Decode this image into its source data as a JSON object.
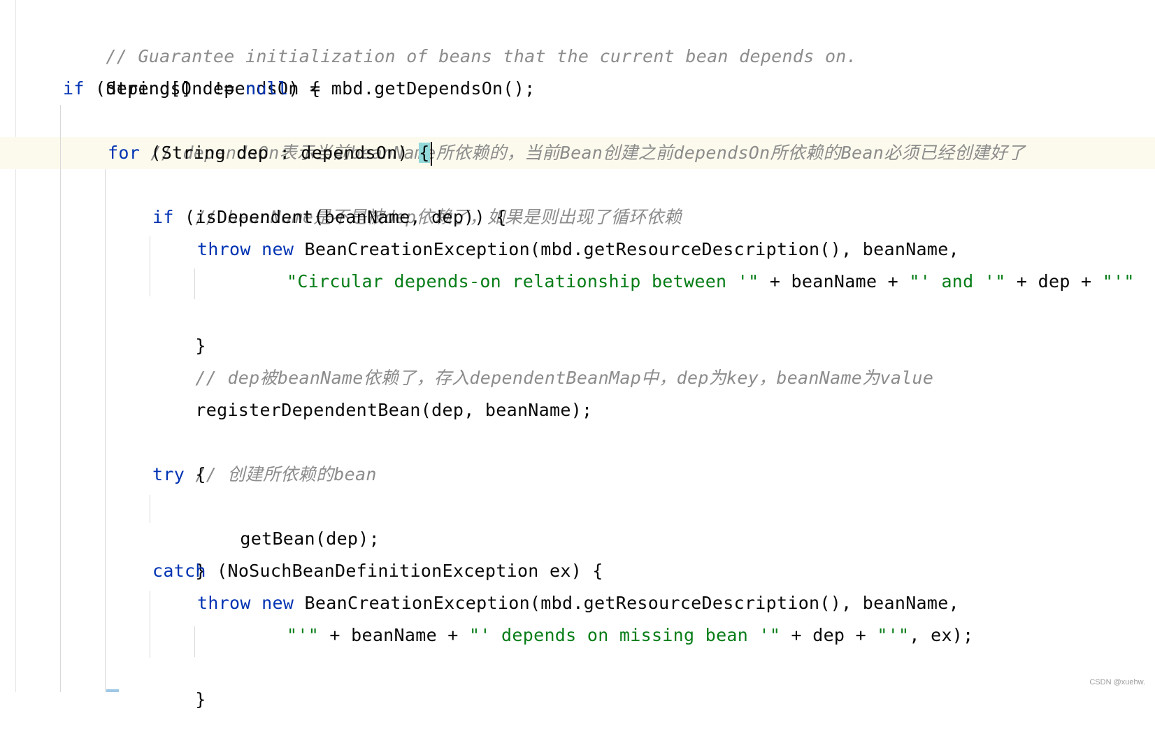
{
  "colors": {
    "keyword": "#0033b3",
    "string": "#067d17",
    "comment": "#8c8c8c",
    "text": "#080808",
    "caret_line": "#fcfaed",
    "brace_match": "#93d9d9"
  },
  "code": {
    "l1": {
      "comment": "// Guarantee initialization of beans that the current bean depends on."
    },
    "l2": {
      "text": "String[] dependsOn = mbd.getDependsOn();"
    },
    "l3": {
      "kw": "if",
      "t1": " (dependsOn != ",
      "kw2": "null",
      "t2": ") {"
    },
    "l4": {
      "comment": "// dependsOn表示当前beanName所依赖的，当前Bean创建之前dependsOn所依赖的Bean必须已经创建好了"
    },
    "l5": {
      "kw": "for",
      "t1": " (String dep : dependsOn) ",
      "brace": "{"
    },
    "l6": {
      "comment": "// beanName是不是被dep依赖了，如果是则出现了循环依赖"
    },
    "l7": {
      "kw": "if",
      "t1": " (isDependent(beanName, dep)) {"
    },
    "l8": {
      "kw": "throw",
      "kw2": "new",
      "t1": " BeanCreationException(mbd.getResourceDescription(), beanName,"
    },
    "l9": {
      "s1": "\"Circular depends-on relationship between '\"",
      "t1": " + beanName + ",
      "s2": "\"' and '\"",
      "t2": " + dep + ",
      "s3": "\"'\""
    },
    "l10": {
      "text": "}"
    },
    "l11": {
      "comment": "// dep被beanName依赖了，存入dependentBeanMap中，dep为key，beanName为value"
    },
    "l12": {
      "text": "registerDependentBean(dep, beanName);"
    },
    "l14": {
      "comment": "// 创建所依赖的bean"
    },
    "l15": {
      "kw": "try",
      "t1": " {"
    },
    "l16": {
      "text": "getBean(dep);"
    },
    "l17": {
      "text": "}"
    },
    "l18": {
      "kw": "catch",
      "t1": " (NoSuchBeanDefinitionException ex) {"
    },
    "l19": {
      "kw": "throw",
      "kw2": "new",
      "t1": " BeanCreationException(mbd.getResourceDescription(), beanName,"
    },
    "l20": {
      "s1": "\"'\"",
      "t1": " + beanName + ",
      "s2": "\"' depends on missing bean '\"",
      "t2": " + dep + ",
      "s3": "\"'\"",
      "t3": ", ex);"
    },
    "l21": {
      "text": "}"
    }
  },
  "watermark": "CSDN @xuehw."
}
